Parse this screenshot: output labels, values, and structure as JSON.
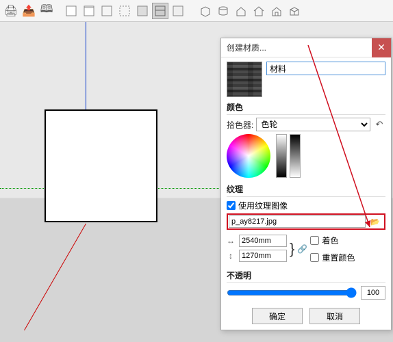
{
  "dialog": {
    "title": "创建材质...",
    "material_name": "材料",
    "color_section": "颜色",
    "picker_label": "拾色器:",
    "picker_value": "色轮",
    "texture_section": "纹理",
    "use_texture_label": "使用纹理图像",
    "texture_file": "p_ay8217.jpg",
    "width_value": "2540mm",
    "height_value": "1270mm",
    "colorize_label": "着色",
    "reset_color_label": "重置颜色",
    "opacity_section": "不透明",
    "opacity_value": "100",
    "ok_label": "确定",
    "cancel_label": "取消"
  }
}
